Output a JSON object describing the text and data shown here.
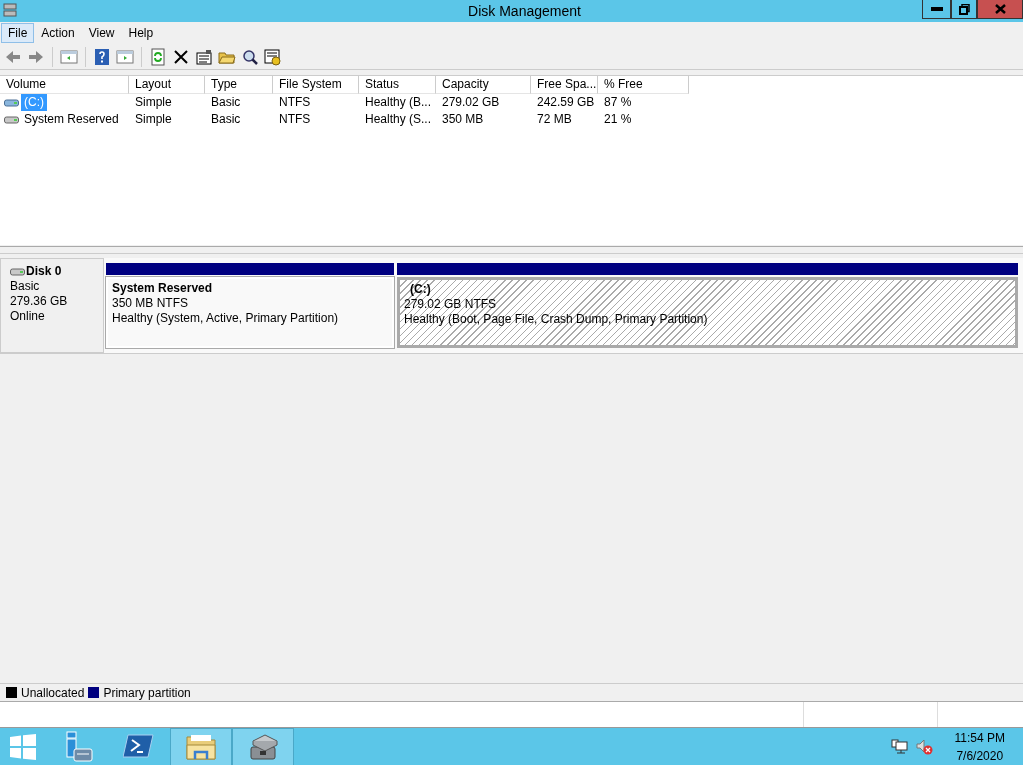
{
  "window": {
    "title": "Disk Management"
  },
  "menu": [
    {
      "label": "File",
      "selected": true
    },
    {
      "label": "Action",
      "selected": false
    },
    {
      "label": "View",
      "selected": false
    },
    {
      "label": "Help",
      "selected": false
    }
  ],
  "table": {
    "columns": [
      "Volume",
      "Layout",
      "Type",
      "File System",
      "Status",
      "Capacity",
      "Free Spa...",
      "% Free"
    ],
    "rows": [
      {
        "selected": true,
        "cells": [
          "(C:)",
          "Simple",
          "Basic",
          "NTFS",
          "Healthy (B...",
          "279.02 GB",
          "242.59 GB",
          "87 %"
        ]
      },
      {
        "selected": false,
        "cells": [
          "System Reserved",
          "Simple",
          "Basic",
          "NTFS",
          "Healthy (S...",
          "350 MB",
          "72 MB",
          "21 %"
        ]
      }
    ]
  },
  "disks": [
    {
      "name": "Disk 0",
      "type": "Basic",
      "size": "279.36 GB",
      "state": "Online",
      "partitions": [
        {
          "name": "System Reserved",
          "size": "350 MB NTFS",
          "status": "Healthy (System, Active, Primary Partition)",
          "selected": false
        },
        {
          "name": "(C:)",
          "size": "279.02 GB NTFS",
          "status": "Healthy (Boot, Page File, Crash Dump, Primary Partition)",
          "selected": true
        }
      ]
    }
  ],
  "legend": [
    {
      "label": "Unallocated",
      "color": "#000000"
    },
    {
      "label": "Primary partition",
      "color": "#000080"
    }
  ],
  "taskbar": {
    "apps": [
      {
        "kind": "server",
        "selected": false
      },
      {
        "kind": "shell",
        "selected": false
      },
      {
        "kind": "explorer",
        "selected": true
      },
      {
        "kind": "disk",
        "selected": true
      }
    ],
    "time": "11:54 PM",
    "date": "7/6/2020"
  }
}
